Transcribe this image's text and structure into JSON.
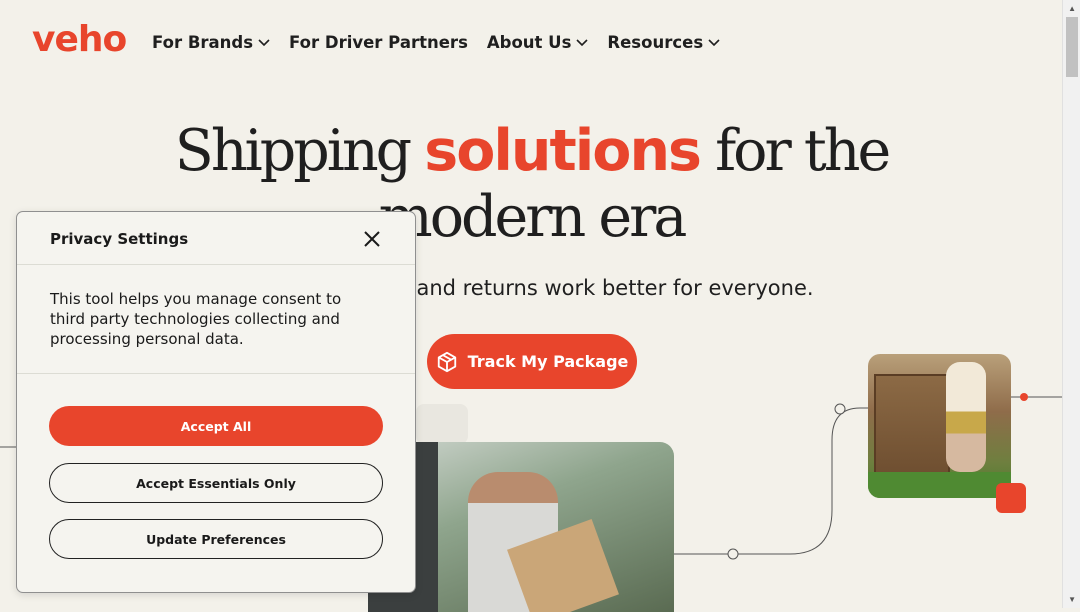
{
  "brand": {
    "logo_text": "veho",
    "accent_color": "#e8452c"
  },
  "nav": {
    "items": [
      {
        "label": "For Brands",
        "has_dropdown": true
      },
      {
        "label": "For Driver Partners",
        "has_dropdown": false
      },
      {
        "label": "About Us",
        "has_dropdown": true
      },
      {
        "label": "Resources",
        "has_dropdown": true
      }
    ]
  },
  "hero": {
    "title_before": "Shipping ",
    "title_accent": "solutions",
    "title_after": " for the",
    "title_line2": "modern era",
    "subtitle": "and returns work better for everyone.",
    "cta_label": "Track My Package",
    "cta_icon": "package-icon"
  },
  "privacy_modal": {
    "title": "Privacy Settings",
    "close_icon": "close-icon",
    "body": "This tool helps you manage consent to third party technologies collecting and processing personal data.",
    "accept_all_label": "Accept All",
    "accept_essentials_label": "Accept Essentials Only",
    "update_preferences_label": "Update Preferences"
  }
}
